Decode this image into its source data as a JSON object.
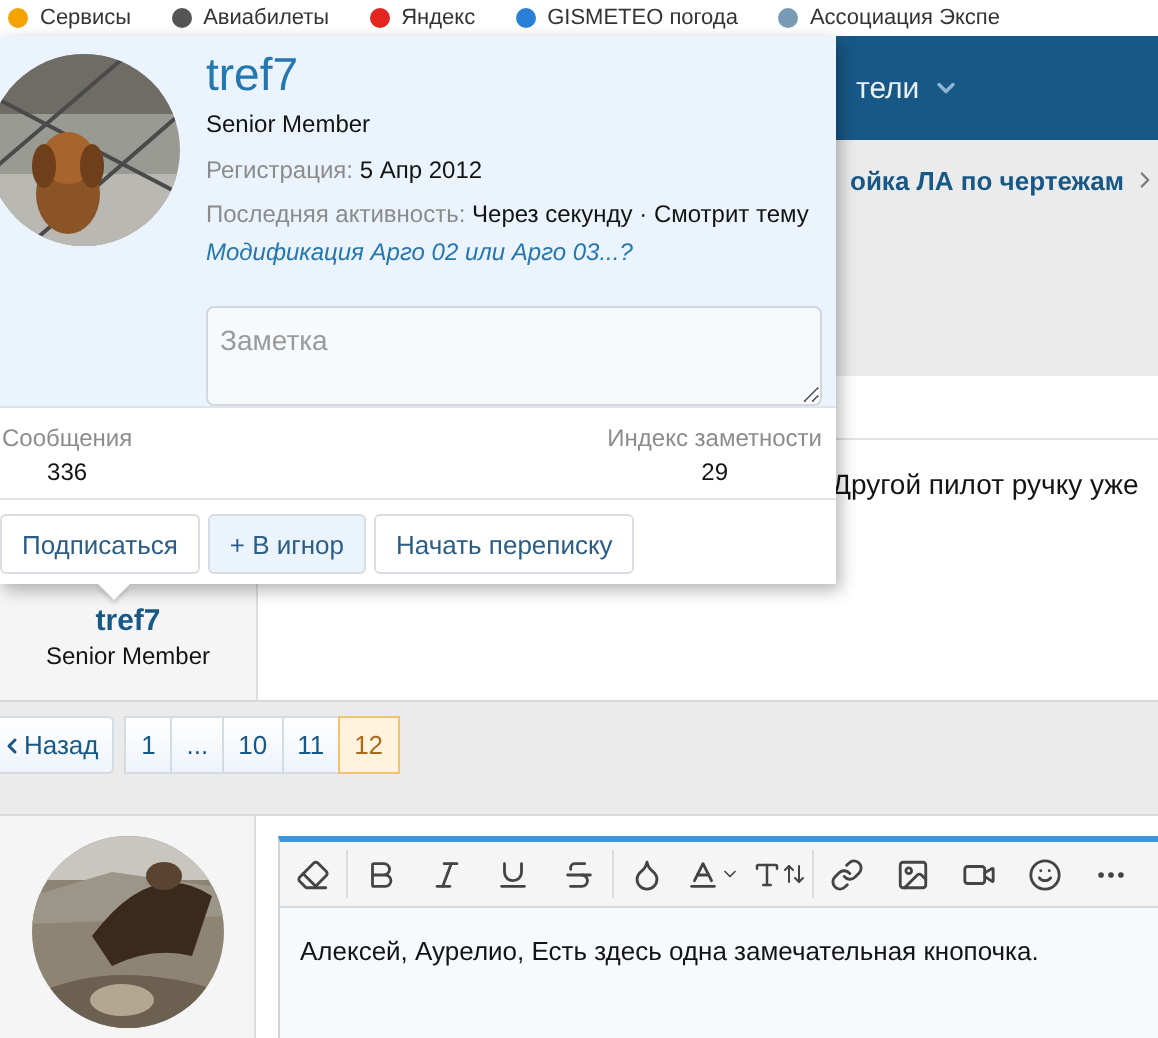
{
  "bookmarks": [
    {
      "label": "Сервисы",
      "color": "#f4a300"
    },
    {
      "label": "Авиабилеты",
      "color": "#555555"
    },
    {
      "label": "Яндекс",
      "color": "#e52620"
    },
    {
      "label": "GISMETEO погода",
      "color": "#2a7fd6"
    },
    {
      "label": "Ассоциация Экспе",
      "color": "#7a9bb5"
    }
  ],
  "nav": {
    "tab_fragment": "тели"
  },
  "breadcrumb": {
    "text": "ойка ЛА по чертежам"
  },
  "post": {
    "text": "Другой пилот ручку уже",
    "author": "tref7",
    "role": "Senior Member"
  },
  "pagination": {
    "prev": "Назад",
    "pages": [
      {
        "label": "1",
        "selected": false
      },
      {
        "label": "...",
        "selected": false
      },
      {
        "label": "10",
        "selected": false
      },
      {
        "label": "11",
        "selected": false
      },
      {
        "label": "12",
        "selected": true
      }
    ]
  },
  "editor": {
    "text": "Алексей, Аурелио, Есть здесь одна замечательная кнопочка."
  },
  "popup": {
    "name": "tref7",
    "title": "Senior Member",
    "registered_label": "Регистрация:",
    "registered": "5 Апр 2012",
    "activity_label": "Последняя активность:",
    "activity": "Через секунду · Смотрит тему",
    "activity_link": "Модификация Арго 02 или Арго 03...?",
    "note_placeholder": "Заметка",
    "stats": [
      {
        "label": "Сообщения",
        "value": "336"
      },
      {
        "label": "Индекс заметности",
        "value": "29"
      }
    ],
    "buttons": [
      {
        "label": "Подписаться",
        "highlighted": false
      },
      {
        "label": "+ В игнор",
        "highlighted": true
      },
      {
        "label": "Начать переписку",
        "highlighted": false
      }
    ]
  }
}
